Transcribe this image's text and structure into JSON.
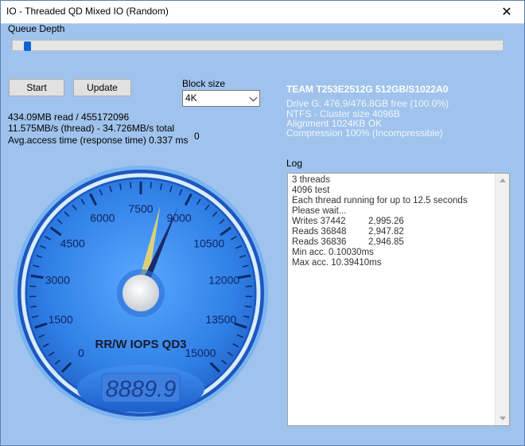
{
  "window": {
    "title": "IO - Threaded QD Mixed IO (Random)",
    "close_label": "✕"
  },
  "queue_depth": {
    "label": "Queue Depth",
    "value_fraction": 0.02
  },
  "buttons": {
    "start": "Start",
    "update": "Update"
  },
  "block_size": {
    "label": "Block size",
    "selected": "4K"
  },
  "stats": {
    "line1": "434.09MB read / 455172096",
    "line2": "11.575MB/s (thread) - 34.726MB/s total",
    "line3": "Avg.access time (response time) 0.337 ms",
    "counter": "0"
  },
  "drive": {
    "title": "TEAM T253E2512G 512GB/S1022A0",
    "info": [
      "Drive G: 476.9/476.8GB free (100.0%)",
      "NTFS - Cluster size 4096B",
      "Alignment 1024KB OK",
      "Compression 100% (Incompressible)"
    ]
  },
  "log": {
    "label": "Log",
    "lines": [
      "3 threads",
      "4096 test",
      "Each thread running for up to 12.5 seconds",
      "Please wait..."
    ],
    "rows": [
      {
        "name": "Writes 37442",
        "value": "2,995.26"
      },
      {
        "name": "Reads 36848",
        "value": "2,947.82"
      },
      {
        "name": "Reads 36836",
        "value": "2,946.85"
      }
    ],
    "tail": [
      "Min acc. 0.10030ms",
      "Max acc. 10.39410ms"
    ]
  },
  "gauge": {
    "title": "RR/W IOPS QD3",
    "display": "8889.9",
    "ticks": [
      "0",
      "1500",
      "3000",
      "4500",
      "6000",
      "7500",
      "9000",
      "10500",
      "12000",
      "13500",
      "15000"
    ],
    "min": 0,
    "max": 15000,
    "needle_value": 8800,
    "needle2_value": 8200,
    "colors": {
      "face": "#3a8cf0",
      "rim": "#bfe0ff",
      "needle": "#1b2a6b",
      "needle2": "#d9d27a"
    }
  }
}
